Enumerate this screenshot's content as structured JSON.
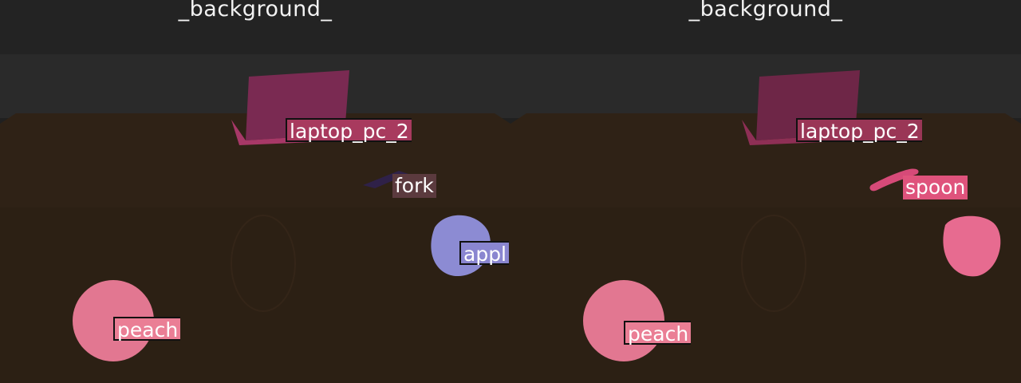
{
  "panels": [
    {
      "id": "left",
      "background_label": "_background_",
      "objects": [
        {
          "label": "laptop_pc_2",
          "color": "#b03c62"
        },
        {
          "label": "fork",
          "color": "#5b3a3e"
        },
        {
          "label": "appl",
          "color": "#8c87d4"
        },
        {
          "label": "peach",
          "color": "#ee7f96"
        }
      ]
    },
    {
      "id": "right",
      "background_label": "_background_",
      "objects": [
        {
          "label": "laptop_pc_2",
          "color": "#9c3756"
        },
        {
          "label": "spoon",
          "color": "#e0527e"
        },
        {
          "label": "peach",
          "color": "#ee7f96"
        }
      ]
    }
  ],
  "colors": {
    "wall": "#202020",
    "floor": "#2e2115",
    "laptop": "#8a2a5a",
    "apple_left": "#8b8ad6",
    "apple_right": "#e76b90",
    "peach": "#e87c94"
  }
}
